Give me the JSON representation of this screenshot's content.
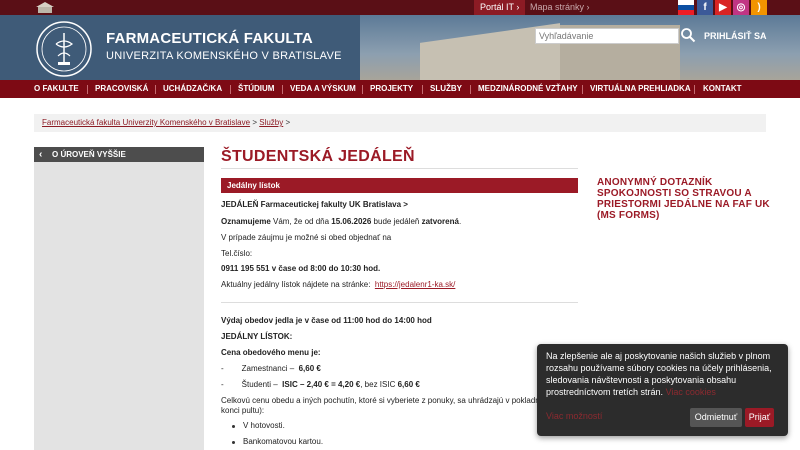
{
  "topbar": {
    "portal_label": "Portál IT",
    "map_label": "Mapa stránky",
    "social": [
      "flag-sk",
      "facebook",
      "youtube",
      "instagram",
      "rss"
    ]
  },
  "header": {
    "title": "FARMACEUTICKÁ FAKULTA",
    "subtitle": "UNIVERZITA KOMENSKÉHO V BRATISLAVE",
    "search_placeholder": "Vyhľadávanie",
    "login_label": "PRIHLÁSIŤ SA"
  },
  "nav": {
    "items": [
      "O FAKULTE",
      "PRACOVISKÁ",
      "UCHÁDZAČ/KA",
      "ŠTÚDIUM",
      "VEDA A VÝSKUM",
      "PROJEKTY",
      "SLUŽBY",
      "MEDZINÁRODNÉ VZŤAHY",
      "VIRTUÁLNA PREHLIADKA",
      "KONTAKT"
    ]
  },
  "breadcrumb": {
    "link1": "Farmaceutická fakulta Univerzity Komenského v Bratislave",
    "sep": ">",
    "link2": "Služby"
  },
  "sidebar": {
    "up_label": "O ÚROVEŇ VYŠŠIE"
  },
  "main": {
    "title": "ŠTUDENTSKÁ JEDÁLEŇ",
    "menu_heading": "Jedálny lístok",
    "line1": "JEDÁLEŇ Farmaceutickej fakulty UK Bratislava >",
    "line2_a": "Oznamujeme",
    "line2_b": " Vám, že od dňa ",
    "line2_c": "15.06.2026",
    "line2_d": " bude jedáleň ",
    "line2_e": "zatvorená",
    "line2_f": ".",
    "line3": "V prípade záujmu je možné si obed objednať na",
    "line4": "Tel.číslo:",
    "line5": "0911 195 551 v čase od 8:00 do 10:30 hod.",
    "line6_a": "Aktuálny jedálny lístok nájdete na stránke:",
    "line6_link": "https://jedalenr1-ka.sk/",
    "line7": "Výdaj obedov jedla je v čase od 11:00 hod  do 14:00 hod",
    "line8": "JEDÁLNY LÍSTOK:",
    "line9": "Cena obedového menu je:",
    "line10_a": "-",
    "line10_b": "Zamestnanci  –",
    "line10_c": "6,60 €",
    "line11_a": "-",
    "line11_b": "Študenti –",
    "line11_c": "ISIC – 2,40 € = 4,20 €",
    "line11_d": ", bez ISIC ",
    "line11_e": "6,60 €",
    "line12": "Celkovú cenu obedu a iných pochutín, ktoré si vyberiete z ponuky, sa uhrádzajú v pokladni",
    "line13": "konci pultu):",
    "bullet1": "V hotovosti.",
    "bullet2": "Bankomatovou kartou."
  },
  "side_link": "ANONYMNÝ DOTAZNÍK SPOKOJNOSTI SO STRAVOU A PRIESTORMI JEDÁLNE NA FAF UK (MS FORMS)",
  "cookie": {
    "text": "Na zlepšenie ale aj poskytovanie našich služieb v plnom rozsahu používame súbory cookies na účely prihlásenia, sledovania návštevnosti a poskytovania obsahu prostredníctvom tretích strán.",
    "inline_link": "Viac cookies",
    "more_label": "Viac možností",
    "reject_label": "Odmietnuť",
    "accept_label": "Prijať"
  },
  "colors": {
    "brand": "#9b1a26",
    "nav": "#7d0a14",
    "header": "#3f5b78"
  }
}
